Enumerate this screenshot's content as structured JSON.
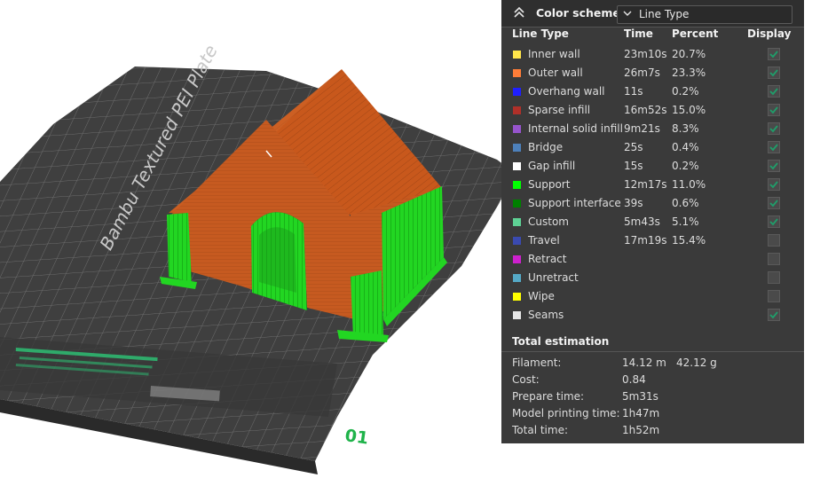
{
  "viewport": {
    "plate_brand_text": "Bambu Textured PEI Plate",
    "plate_number": "01"
  },
  "panel": {
    "header": {
      "title": "Color scheme",
      "selected": "Line Type"
    },
    "columns": {
      "line_type": "Line Type",
      "time": "Time",
      "percent": "Percent",
      "display": "Display"
    },
    "rows": [
      {
        "name": "Inner wall",
        "time": "23m10s",
        "percent": "20.7%",
        "color": "#ffe54a",
        "display": true
      },
      {
        "name": "Outer wall",
        "time": "26m7s",
        "percent": "23.3%",
        "color": "#ff7d38",
        "display": true
      },
      {
        "name": "Overhang wall",
        "time": "11s",
        "percent": "0.2%",
        "color": "#1f1fff",
        "display": true
      },
      {
        "name": "Sparse infill",
        "time": "16m52s",
        "percent": "15.0%",
        "color": "#b03029",
        "display": true
      },
      {
        "name": "Internal solid infill",
        "time": "9m21s",
        "percent": "8.3%",
        "color": "#9654cc",
        "display": true
      },
      {
        "name": "Bridge",
        "time": "25s",
        "percent": "0.4%",
        "color": "#4d80ba",
        "display": true
      },
      {
        "name": "Gap infill",
        "time": "15s",
        "percent": "0.2%",
        "color": "#ffffff",
        "display": true
      },
      {
        "name": "Support",
        "time": "12m17s",
        "percent": "11.0%",
        "color": "#00ff00",
        "display": true
      },
      {
        "name": "Support interface",
        "time": "39s",
        "percent": "0.6%",
        "color": "#008000",
        "display": true
      },
      {
        "name": "Custom",
        "time": "5m43s",
        "percent": "5.1%",
        "color": "#5ed194",
        "display": true
      },
      {
        "name": "Travel",
        "time": "17m19s",
        "percent": "15.4%",
        "color": "#3a4ab0",
        "display": false
      },
      {
        "name": "Retract",
        "time": "",
        "percent": "",
        "color": "#cd20cd",
        "display": false
      },
      {
        "name": "Unretract",
        "time": "",
        "percent": "",
        "color": "#55a9c6",
        "display": false
      },
      {
        "name": "Wipe",
        "time": "",
        "percent": "",
        "color": "#ffff00",
        "display": false
      },
      {
        "name": "Seams",
        "time": "",
        "percent": "",
        "color": "#e6e6e6",
        "display": true
      }
    ],
    "totals": {
      "title": "Total estimation",
      "filament_label": "Filament:",
      "filament_length": "14.12 m",
      "filament_weight": "42.12 g",
      "cost_label": "Cost:",
      "cost": "0.84",
      "prepare_label": "Prepare time:",
      "prepare": "5m31s",
      "model_label": "Model printing time:",
      "model": "1h47m",
      "total_label": "Total time:",
      "total": "1h52m"
    },
    "check_color": "#1f9e6a"
  }
}
